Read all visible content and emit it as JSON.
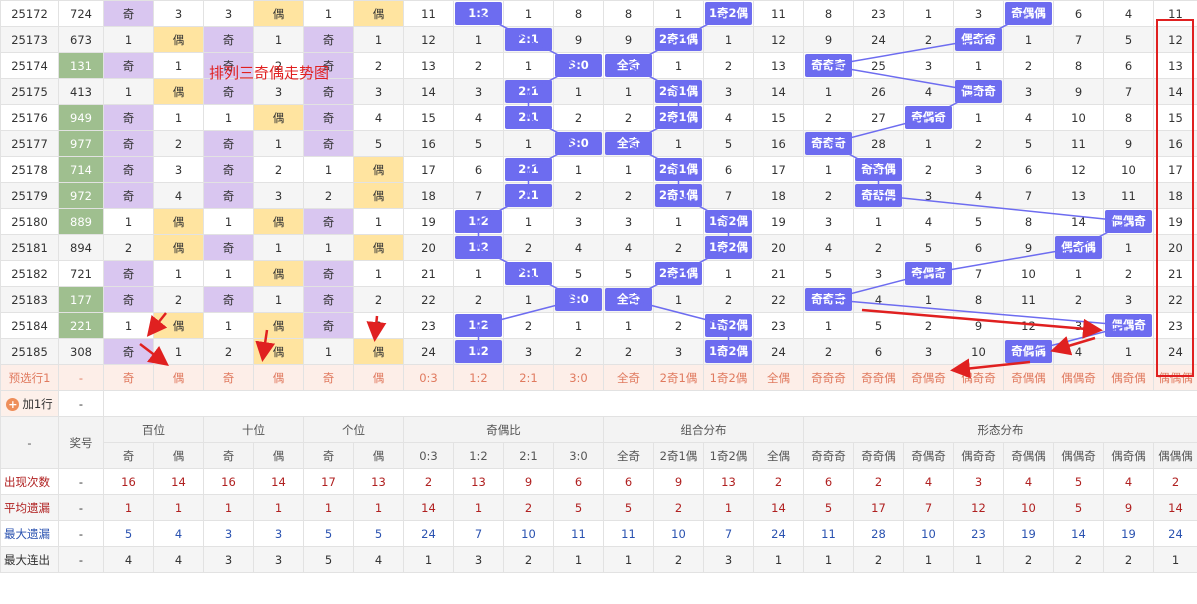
{
  "title": "排列三奇偶走势图",
  "columns": [
    "issue",
    "prize",
    "h_odd",
    "h_even",
    "t_odd",
    "t_even",
    "u_odd",
    "u_even",
    "r03",
    "r12",
    "r21",
    "r30",
    "c_all_odd",
    "c_2o1e",
    "c_1o2e",
    "c_all_even",
    "s_qqq",
    "s_qqo",
    "s_qoq",
    "s_oqq",
    "s_qoo",
    "s_ooq",
    "s_oqo",
    "s_ooo"
  ],
  "rows": [
    {
      "issue": "25172",
      "prize": "724",
      "cells": [
        "奇",
        "3",
        "3",
        "偶",
        "1",
        "偶",
        "11",
        "1:2",
        "1",
        "8",
        "8",
        "1",
        "1奇2偶",
        "11",
        "8",
        "23",
        "1",
        "3",
        "奇偶偶",
        "6",
        "4",
        "11"
      ]
    },
    {
      "issue": "25173",
      "prize": "673",
      "cells": [
        "1",
        "偶",
        "奇",
        "1",
        "奇",
        "1",
        "12",
        "1",
        "2:1",
        "9",
        "9",
        "2奇1偶",
        "1",
        "12",
        "9",
        "24",
        "2",
        "偶奇奇",
        "1",
        "7",
        "5",
        "12"
      ]
    },
    {
      "issue": "25174",
      "prize": "131",
      "cells": [
        "奇",
        "1",
        "奇",
        "2",
        "奇",
        "2",
        "13",
        "2",
        "1",
        "3:0",
        "全奇",
        "1",
        "2",
        "13",
        "奇奇奇",
        "25",
        "3",
        "1",
        "2",
        "8",
        "6",
        "13"
      ]
    },
    {
      "issue": "25175",
      "prize": "413",
      "cells": [
        "1",
        "偶",
        "奇",
        "3",
        "奇",
        "3",
        "14",
        "3",
        "2:1",
        "1",
        "1",
        "2奇1偶",
        "3",
        "14",
        "1",
        "26",
        "4",
        "偶奇奇",
        "3",
        "9",
        "7",
        "14"
      ]
    },
    {
      "issue": "25176",
      "prize": "949",
      "cells": [
        "奇",
        "1",
        "1",
        "偶",
        "奇",
        "4",
        "15",
        "4",
        "2:1",
        "2",
        "2",
        "2奇1偶",
        "4",
        "15",
        "2",
        "27",
        "奇偶奇",
        "1",
        "4",
        "10",
        "8",
        "15"
      ]
    },
    {
      "issue": "25177",
      "prize": "977",
      "cells": [
        "奇",
        "2",
        "奇",
        "1",
        "奇",
        "5",
        "16",
        "5",
        "1",
        "3:0",
        "全奇",
        "1",
        "5",
        "16",
        "奇奇奇",
        "28",
        "1",
        "2",
        "5",
        "11",
        "9",
        "16"
      ]
    },
    {
      "issue": "25178",
      "prize": "714",
      "cells": [
        "奇",
        "3",
        "奇",
        "2",
        "1",
        "偶",
        "17",
        "6",
        "2:1",
        "1",
        "1",
        "2奇1偶",
        "6",
        "17",
        "1",
        "奇奇偶",
        "2",
        "3",
        "6",
        "12",
        "10",
        "17"
      ]
    },
    {
      "issue": "25179",
      "prize": "972",
      "cells": [
        "奇",
        "4",
        "奇",
        "3",
        "2",
        "偶",
        "18",
        "7",
        "2:1",
        "2",
        "2",
        "2奇1偶",
        "7",
        "18",
        "2",
        "奇奇偶",
        "3",
        "4",
        "7",
        "13",
        "11",
        "18"
      ]
    },
    {
      "issue": "25180",
      "prize": "889",
      "cells": [
        "1",
        "偶",
        "1",
        "偶",
        "奇",
        "1",
        "19",
        "1:2",
        "1",
        "3",
        "3",
        "1",
        "1奇2偶",
        "19",
        "3",
        "1",
        "4",
        "5",
        "8",
        "14",
        "偶偶奇",
        "19"
      ]
    },
    {
      "issue": "25181",
      "prize": "894",
      "cells": [
        "2",
        "偶",
        "奇",
        "1",
        "1",
        "偶",
        "20",
        "1:2",
        "2",
        "4",
        "4",
        "2",
        "1奇2偶",
        "20",
        "4",
        "2",
        "5",
        "6",
        "9",
        "偶奇偶",
        "1",
        "20"
      ]
    },
    {
      "issue": "25182",
      "prize": "721",
      "cells": [
        "奇",
        "1",
        "1",
        "偶",
        "奇",
        "1",
        "21",
        "1",
        "2:1",
        "5",
        "5",
        "2奇1偶",
        "1",
        "21",
        "5",
        "3",
        "奇偶奇",
        "7",
        "10",
        "1",
        "2",
        "21"
      ]
    },
    {
      "issue": "25183",
      "prize": "177",
      "cells": [
        "奇",
        "2",
        "奇",
        "1",
        "奇",
        "2",
        "22",
        "2",
        "1",
        "3:0",
        "全奇",
        "1",
        "2",
        "22",
        "奇奇奇",
        "4",
        "1",
        "8",
        "11",
        "2",
        "3",
        "22"
      ]
    },
    {
      "issue": "25184",
      "prize": "221",
      "cells": [
        "1",
        "偶",
        "1",
        "偶",
        "奇",
        "3",
        "23",
        "1:2",
        "2",
        "1",
        "1",
        "2",
        "1奇2偶",
        "23",
        "1",
        "5",
        "2",
        "9",
        "12",
        "3",
        "偶偶奇",
        "23"
      ]
    },
    {
      "issue": "25185",
      "prize": "308",
      "cells": [
        "奇",
        "1",
        "2",
        "偶",
        "1",
        "偶",
        "24",
        "1:2",
        "3",
        "2",
        "2",
        "3",
        "1奇2偶",
        "24",
        "2",
        "6",
        "3",
        "10",
        "奇偶偶",
        "4",
        "1",
        "24"
      ]
    }
  ],
  "predict": {
    "label": "预选行1",
    "prize": "-",
    "cells": [
      "奇",
      "偶",
      "奇",
      "偶",
      "奇",
      "偶",
      "0:3",
      "1:2",
      "2:1",
      "3:0",
      "全奇",
      "2奇1偶",
      "1奇2偶",
      "全偶",
      "奇奇奇",
      "奇奇偶",
      "奇偶奇",
      "偶奇奇",
      "奇偶偶",
      "偶偶奇",
      "偶奇偶",
      "偶偶偶"
    ]
  },
  "add_row": {
    "label": "加1行",
    "value": "-"
  },
  "header": {
    "dash": "-",
    "prize": "奖号",
    "groups": [
      "百位",
      "十位",
      "个位",
      "奇偶比",
      "组合分布",
      "形态分布"
    ],
    "sub": [
      "奇",
      "偶",
      "奇",
      "偶",
      "奇",
      "偶",
      "0:3",
      "1:2",
      "2:1",
      "3:0",
      "全奇",
      "2奇1偶",
      "1奇2偶",
      "全偶",
      "奇奇奇",
      "奇奇偶",
      "奇偶奇",
      "偶奇奇",
      "奇偶偶",
      "偶偶奇",
      "偶奇偶",
      "偶偶偶"
    ]
  },
  "stats": [
    {
      "label": "出现次数",
      "color": "red",
      "values": [
        "16",
        "14",
        "16",
        "14",
        "17",
        "13",
        "2",
        "13",
        "9",
        "6",
        "6",
        "9",
        "13",
        "2",
        "6",
        "2",
        "4",
        "3",
        "4",
        "5",
        "4",
        "2"
      ]
    },
    {
      "label": "平均遗漏",
      "color": "red",
      "values": [
        "1",
        "1",
        "1",
        "1",
        "1",
        "1",
        "14",
        "1",
        "2",
        "5",
        "5",
        "2",
        "1",
        "14",
        "5",
        "17",
        "7",
        "12",
        "10",
        "5",
        "9",
        "14"
      ]
    },
    {
      "label": "最大遗漏",
      "color": "blue",
      "values": [
        "5",
        "4",
        "3",
        "3",
        "5",
        "5",
        "24",
        "7",
        "10",
        "11",
        "11",
        "10",
        "7",
        "24",
        "11",
        "28",
        "10",
        "23",
        "19",
        "14",
        "19",
        "24"
      ]
    },
    {
      "label": "最大连出",
      "color": "dark",
      "values": [
        "4",
        "4",
        "3",
        "3",
        "5",
        "4",
        "1",
        "3",
        "2",
        "1",
        "1",
        "2",
        "3",
        "1",
        "1",
        "2",
        "1",
        "1",
        "2",
        "2",
        "2",
        "1"
      ]
    }
  ],
  "colors": {
    "odd": "#d9c6f0",
    "even": "#ffe4a0",
    "ball": "#6d6cf0",
    "sum": "#9fbf8f",
    "accent": "#e02020",
    "pred": "#fdeee8"
  }
}
